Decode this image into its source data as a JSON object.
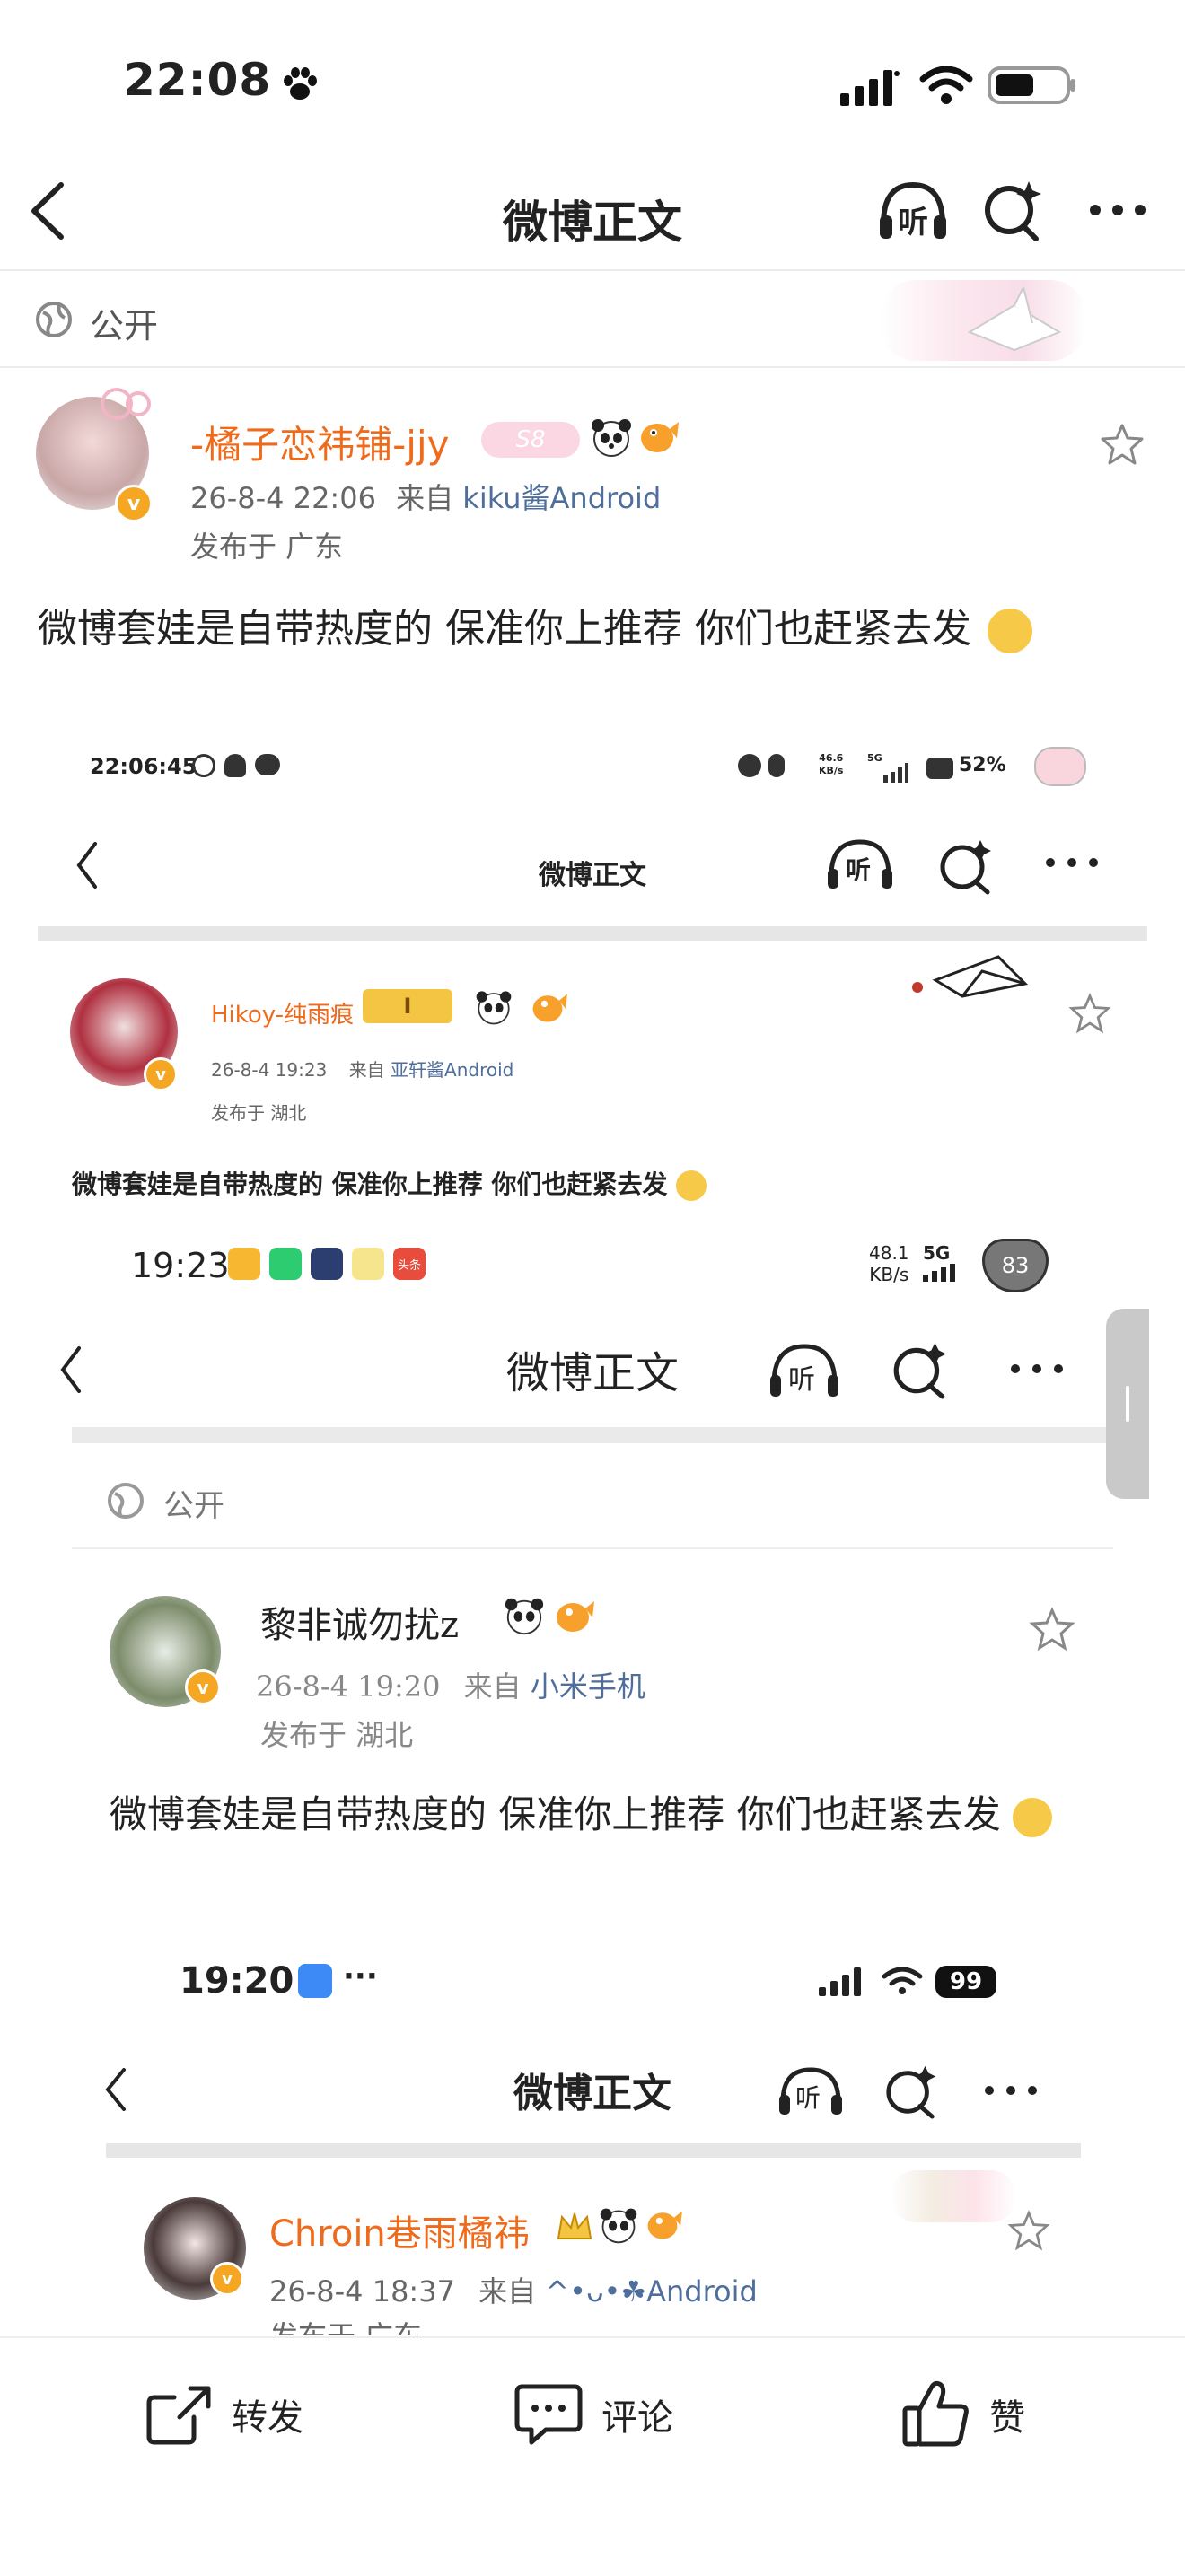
{
  "status_bar": {
    "time": "22:08",
    "paw_icon": "paw-icon",
    "signal": "signal-icon",
    "wifi": "wifi-icon",
    "battery": "battery-icon"
  },
  "header": {
    "title": "微博正文",
    "back": "back-arrow-icon",
    "listen_label": "听",
    "more": "more-icon"
  },
  "visibility": {
    "label": "公开"
  },
  "post": {
    "author": "-橘子恋祎铺-jjy",
    "level_badge": "S8",
    "time": "26-8-4 22:06",
    "source_prefix": "来自",
    "source": "kiku酱Android",
    "location": "发布于 广东",
    "text": "微博套娃是自带热度的 保准你上推荐 你们也赶紧去发"
  },
  "shot1": {
    "time": "22:06:45",
    "status_right": "52%",
    "net_speed": "46.6",
    "net_speed_unit": "KB/s",
    "net_type": "5G",
    "title": "微博正文",
    "listen_label": "听",
    "author": "Hikoy-纯雨痕",
    "badge": "I",
    "time_posted": "26-8-4 19:23",
    "source_prefix": "来自",
    "source": "亚轩酱Android",
    "location": "发布于 湖北",
    "text": "微博套娃是自带热度的 保准你上推荐 你们也赶紧去发"
  },
  "shot2": {
    "time": "19:23",
    "net_speed": "48.1",
    "net_speed_unit": "KB/s",
    "net_type": "5G",
    "battery": "83",
    "app_badge": "头条",
    "title": "微博正文",
    "listen_label": "听",
    "visibility": "公开",
    "author": "黎非诚勿扰z",
    "time_posted": "26-8-4 19:20",
    "source_prefix": "来自",
    "source": "小米手机",
    "location": "发布于 湖北",
    "text": "微博套娃是自带热度的 保准你上推荐 你们也赶紧去发"
  },
  "shot3": {
    "time": "19:20",
    "more_dots": "···",
    "battery": "99",
    "title": "微博正文",
    "listen_label": "听",
    "author": "Chroin巷雨橘祎",
    "time_posted": "26-8-4 18:37",
    "source_prefix": "来自",
    "source": "^•ᴗ•☘Android",
    "location": "发布于 广东"
  },
  "bottom_bar": {
    "repost": "转发",
    "comment": "评论",
    "like": "赞"
  },
  "colors": {
    "accent_orange": "#f06a1b",
    "link_blue": "#4f6e9b",
    "badge_yellow": "#f5a623"
  }
}
